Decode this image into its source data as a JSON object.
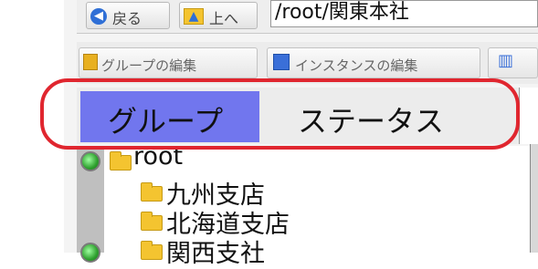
{
  "nav": {
    "back_label": "戻る",
    "up_label": "上へ",
    "path": "/root/関東本社"
  },
  "toolbar": {
    "edit_group_label": "グループの編集",
    "edit_instance_label": "インスタンスの編集"
  },
  "tabs": [
    {
      "label": "グループ",
      "selected": true
    },
    {
      "label": "ステータス",
      "selected": false
    }
  ],
  "tree": {
    "root_label": "root",
    "children": [
      "九州支店",
      "北海道支店",
      "関西支社"
    ]
  },
  "colors": {
    "selected_tab": "#7176ee",
    "highlight_ring": "#e0262f",
    "folder": "#f4c430"
  }
}
